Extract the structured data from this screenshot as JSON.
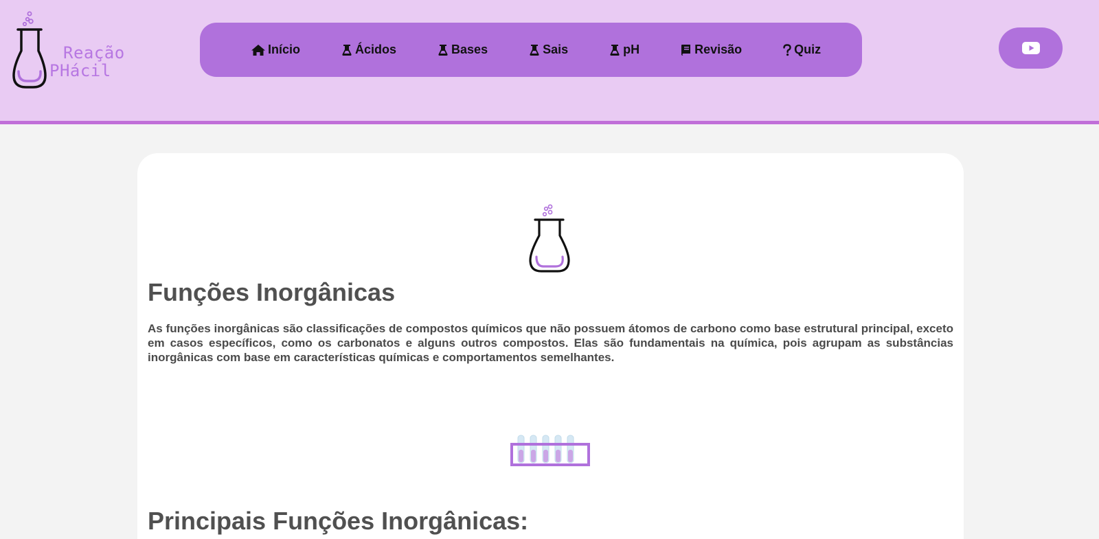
{
  "header": {
    "logo": {
      "line1": "Reação",
      "line2": "PHácil"
    },
    "nav": [
      {
        "label": "Início",
        "icon": "home-icon"
      },
      {
        "label": "Ácidos",
        "icon": "flask-icon"
      },
      {
        "label": "Bases",
        "icon": "flask-icon"
      },
      {
        "label": "Sais",
        "icon": "flask-icon"
      },
      {
        "label": "pH",
        "icon": "flask-icon"
      },
      {
        "label": "Revisão",
        "icon": "book-icon"
      },
      {
        "label": "Quiz",
        "icon": "question-icon"
      }
    ],
    "social": {
      "icon": "youtube-icon"
    }
  },
  "main": {
    "title": "Funções Inorgânicas",
    "intro": "As funções inorgânicas são classificações de compostos químicos que não possuem átomos de carbono como base estrutural principal, exceto em casos específicos, como os carbonatos e alguns outros compostos. Elas são fundamentais na química, pois agrupam as substâncias inorgânicas com base em características químicas e comportamentos semelhantes.",
    "subtitle": "Principais Funções Inorgânicas:"
  },
  "colors": {
    "header_bg": "#e9cbf3",
    "accent": "#b071dc",
    "header_border": "#c06ed8",
    "text": "#505050"
  }
}
